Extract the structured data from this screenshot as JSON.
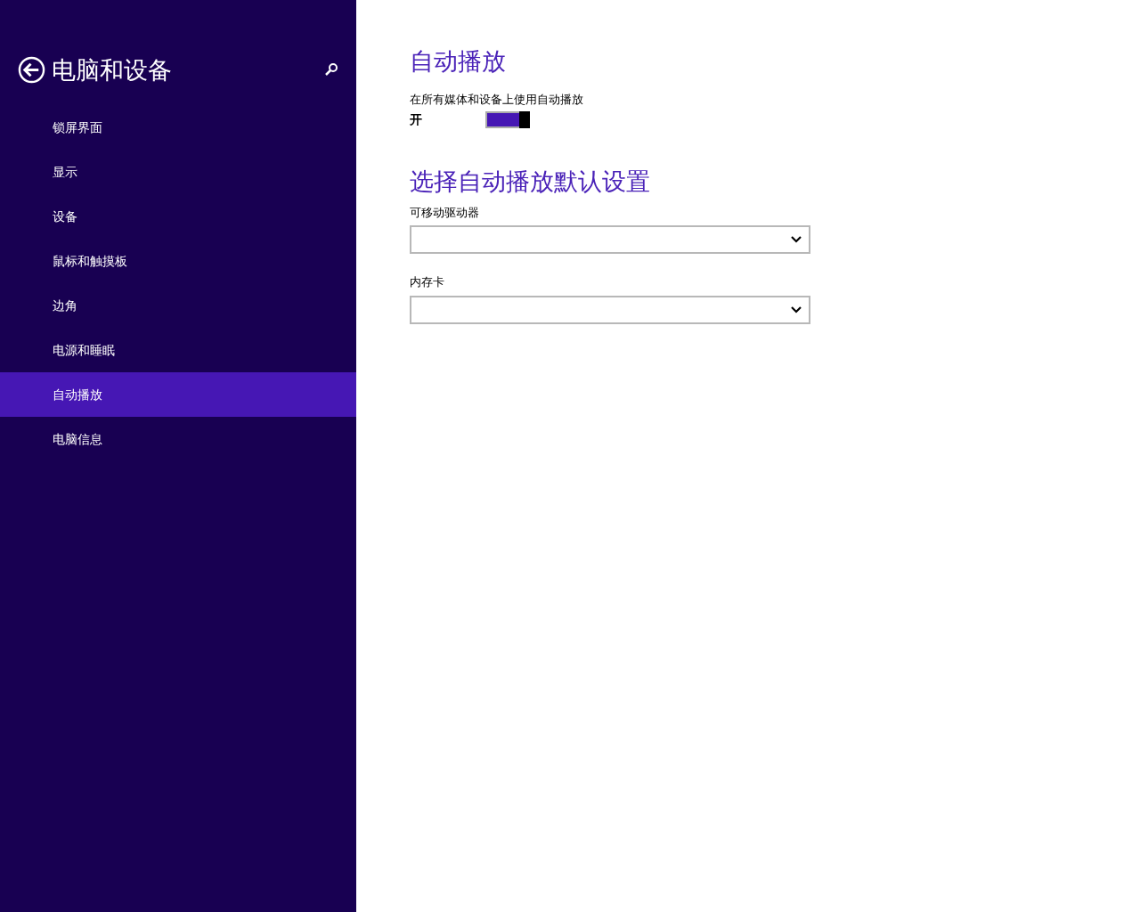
{
  "sidebar": {
    "title": "电脑和设备",
    "items": [
      {
        "label": "锁屏界面",
        "selected": false
      },
      {
        "label": "显示",
        "selected": false
      },
      {
        "label": "设备",
        "selected": false
      },
      {
        "label": "鼠标和触摸板",
        "selected": false
      },
      {
        "label": "边角",
        "selected": false
      },
      {
        "label": "电源和睡眠",
        "selected": false
      },
      {
        "label": "自动播放",
        "selected": true
      },
      {
        "label": "电脑信息",
        "selected": false
      }
    ]
  },
  "autoplay": {
    "heading": "自动播放",
    "toggle": {
      "label": "在所有媒体和设备上使用自动播放",
      "state_text": "开",
      "on": true
    }
  },
  "defaults": {
    "heading": "选择自动播放默认设置",
    "dropdowns": [
      {
        "label": "可移动驱动器"
      },
      {
        "label": "内存卡"
      }
    ]
  }
}
